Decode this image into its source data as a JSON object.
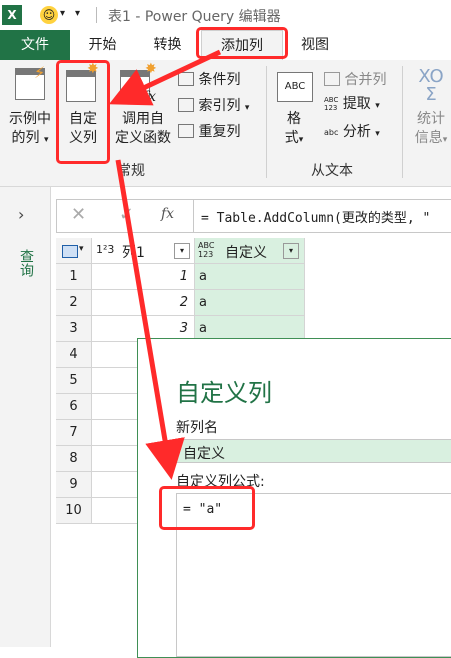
{
  "window": {
    "title": "表1 - Power Query 编辑器"
  },
  "tabs": [
    "文件",
    "开始",
    "转换",
    "添加列",
    "视图"
  ],
  "ribbon": {
    "example_line1": "示例中",
    "example_line2": "的列",
    "custom_line1": "自定",
    "custom_line2": "义列",
    "invoke_line1": "调用自",
    "invoke_line2": "定义函数",
    "conditional": "条件列",
    "index": "索引列",
    "duplicate": "重复列",
    "group_general": "常规",
    "format_line1": "格",
    "format_line2": "式",
    "merge": "合并列",
    "extract": "提取",
    "parse": "分析",
    "group_text": "从文本",
    "stats_line1": "统计",
    "stats_line2": "信息",
    "abc_glyph": "ABC",
    "abc123_top": "ABC",
    "abc123_bottom": "123",
    "abc_small": "abc",
    "sigma": "XO\nΣ"
  },
  "side_pane": {
    "label": "查询"
  },
  "formula_bar": {
    "cancel": "✕",
    "confirm": "✓",
    "fx": "fx",
    "formula": "= Table.AddColumn(更改的类型, \""
  },
  "table": {
    "columns": [
      {
        "type": "1²3",
        "name": "列1"
      },
      {
        "type_top": "ABC",
        "type_bottom": "123",
        "name": "自定义"
      }
    ],
    "rows": [
      [
        "1",
        "1",
        "a"
      ],
      [
        "2",
        "2",
        "a"
      ],
      [
        "3",
        "3",
        "a"
      ],
      [
        "4",
        "",
        ""
      ],
      [
        "5",
        "",
        ""
      ],
      [
        "6",
        "",
        ""
      ],
      [
        "7",
        "",
        ""
      ],
      [
        "8",
        "",
        ""
      ],
      [
        "9",
        "",
        ""
      ],
      [
        "10",
        "",
        ""
      ]
    ]
  },
  "dialog": {
    "title": "自定义列",
    "new_col_label": "新列名",
    "new_col_value": "自定义",
    "formula_label": "自定义列公式:",
    "formula_value": "= \"a\""
  },
  "colors": {
    "excel_green": "#217346",
    "highlight_red": "#ff2a2a",
    "custom_column_fill": "#d9f0e0",
    "dialog_title": "#217346"
  },
  "icons": [
    "excel-logo-icon",
    "smiley-icon",
    "dropdown-arrow-icon",
    "expand-pane-icon",
    "table-menu-icon",
    "filter-dropdown-icon",
    "column-with-star-icon",
    "function-icon"
  ]
}
